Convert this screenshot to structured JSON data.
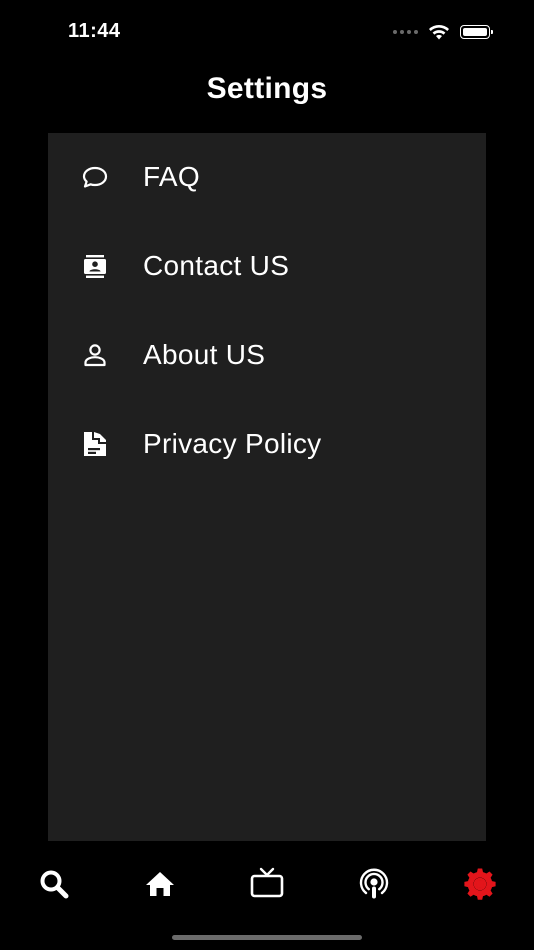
{
  "status_bar": {
    "time": "11:44"
  },
  "page": {
    "title": "Settings"
  },
  "menu": {
    "items": [
      {
        "label": "FAQ",
        "icon": "chat-bubble-icon"
      },
      {
        "label": "Contact US",
        "icon": "contact-card-icon"
      },
      {
        "label": "About US",
        "icon": "person-icon"
      },
      {
        "label": "Privacy Policy",
        "icon": "document-icon"
      }
    ]
  },
  "tab_bar": {
    "tabs": [
      {
        "icon": "search-icon",
        "active": false
      },
      {
        "icon": "home-icon",
        "active": false
      },
      {
        "icon": "tv-icon",
        "active": false
      },
      {
        "icon": "podcast-icon",
        "active": false
      },
      {
        "icon": "gear-icon",
        "active": true
      }
    ],
    "active_color": "#e3151b",
    "inactive_color": "#ffffff"
  },
  "colors": {
    "background": "#000000",
    "panel": "#1f1f1f",
    "text": "#ffffff"
  }
}
